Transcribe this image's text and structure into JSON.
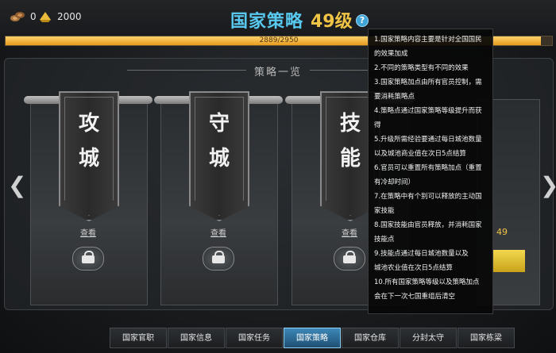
{
  "resources": {
    "wood": "0",
    "gold": "2000"
  },
  "header": {
    "title": "国家策略",
    "level": "49级",
    "help_label": "?"
  },
  "progress": {
    "text": "2889/2950",
    "current": 2889,
    "max": 2950
  },
  "section": {
    "title": "策略一览"
  },
  "cards": [
    {
      "chars": [
        "攻",
        "城"
      ],
      "view": "查看"
    },
    {
      "chars": [
        "守",
        "城"
      ],
      "view": "查看"
    },
    {
      "chars": [
        "技",
        "能"
      ],
      "view": "查看"
    }
  ],
  "right_card": {
    "level": "49"
  },
  "tooltip": {
    "lines": [
      "1.国家策略内容主要是针对全国国民",
      "的效果加成",
      "2.不同的策略类型有不同的效果",
      "3.国家策略加点由所有官员控制，需",
      "要消耗策略点",
      "4.策略点通过国家策略等级提升而获",
      "得",
      "5.升级所需经验要通过每日城池数量",
      "以及城池商业值在次日5点结算",
      "6.官员可以重置所有策略加点（重置",
      "有冷却时间）",
      "7.在策略中有个别可以释放的主动国",
      "家技能",
      "8.国家技能由官员释放，并消耗国家",
      "技能点",
      "9.技能点通过每日城池数量以及",
      "城池农业值在次日5点结算",
      "10.所有国家策略等级以及策略加点",
      "会在下一次七国重组后清空"
    ]
  },
  "tabs": [
    "国家官职",
    "国家信息",
    "国家任务",
    "国家策略",
    "国家仓库",
    "分封太守",
    "国家栋梁"
  ],
  "active_tab": "国家策略",
  "colors": {
    "title": "#58c8ee",
    "level": "#f0c445",
    "progress": "#e79a1f",
    "active_tab": "#3d88b8"
  }
}
